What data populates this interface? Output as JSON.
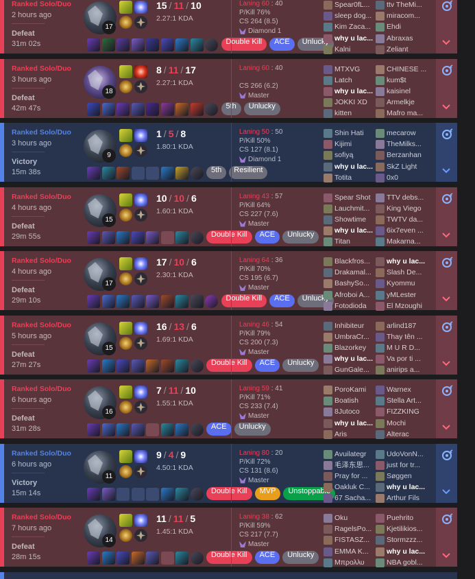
{
  "colors": {
    "loss_bg": "#59343b",
    "win_bg": "#28344e",
    "loss_accent": "#e84057",
    "win_accent": "#5383e8"
  },
  "matches": [
    {
      "result": "loss",
      "queue": "Ranked Solo/Duo",
      "ago": "2 hours ago",
      "outcome": "Defeat",
      "duration": "31m 02s",
      "level": "17",
      "kills": "15",
      "deaths": "11",
      "assists": "10",
      "kda": "2.27:1 KDA",
      "laning": "Laning 60",
      "laning_opp": "40",
      "pkill": "P/Kill 76%",
      "cs": "CS 264 (8.5)",
      "rank": "Diamond 1",
      "badges": [
        {
          "label": "Double Kill",
          "style": "red"
        },
        {
          "label": "ACE",
          "style": "blue"
        },
        {
          "label": "Unlucky",
          "style": "gray"
        }
      ],
      "items": [
        "#6a3cb8",
        "#2f6a3a",
        "#5b3ea0",
        "#7a5cc8",
        "#3a3a9a",
        "#4a4ac0",
        "#2a7ac8",
        "#2a8aa0",
        "#4a4a58"
      ],
      "team1": [
        "Spear0fL...",
        "sleep dog...",
        "Kim Zaca...",
        "why u lac...",
        "Kalni"
      ],
      "team2": [
        "ttv TheMi...",
        "miracom...",
        "Ehdi",
        "Abraxas",
        "Zeliant"
      ],
      "me": 3
    },
    {
      "result": "loss",
      "queue": "Ranked Solo/Duo",
      "ago": "3 hours ago",
      "outcome": "Defeat",
      "duration": "42m 47s",
      "level": "18",
      "kills": "8",
      "deaths": "11",
      "assists": "17",
      "kda": "2.27:1 KDA",
      "laning": "Laning 60",
      "laning_opp": "40",
      "pkill": "",
      "cs": "CS 266 (6.2)",
      "rank": "Master",
      "badges": [
        {
          "label": "5th",
          "style": "gray"
        },
        {
          "label": "Unlucky",
          "style": "gray"
        }
      ],
      "items": [
        "#3a4ac0",
        "#4a6ad0",
        "#6a3cb8",
        "#5a5ab8",
        "#4a2a90",
        "#8a3a9a",
        "#c86a2a",
        "#c83a2a",
        "#4a4a58"
      ],
      "team1": [
        "MTXVG",
        "Latch",
        "why u lac...",
        "JOKKI XD",
        "kitten"
      ],
      "team2": [
        "CHINESE ...",
        "kum$t",
        "kaisinel",
        "Armelkje",
        "Mafro ma..."
      ],
      "me": 2
    },
    {
      "result": "win",
      "queue": "Ranked Solo/Duo",
      "ago": "3 hours ago",
      "outcome": "Victory",
      "duration": "15m 38s",
      "level": "9",
      "kills": "1",
      "deaths": "5",
      "assists": "8",
      "kda": "1.80:1 KDA",
      "laning": "Laning 50",
      "laning_opp": "50",
      "pkill": "P/Kill 50%",
      "cs": "CS 127 (8.1)",
      "rank": "Diamond 1",
      "badges": [
        {
          "label": "5th",
          "style": "gray"
        },
        {
          "label": "Resilient",
          "style": "gray"
        }
      ],
      "items": [
        "#6a3cb8",
        "#2a8aa0",
        "#a04a2a",
        "empty",
        "empty",
        "#2a7ac8",
        "#c8a02a",
        "#4a4a58"
      ],
      "team1": [
        "Shin Hati",
        "Kijimi",
        "sofiyą",
        "why u lac...",
        "Totita"
      ],
      "team2": [
        "mecarow",
        "TheMilks...",
        "Berzanhan",
        "SkZ Light",
        "0x0"
      ],
      "me": 3
    },
    {
      "result": "loss",
      "queue": "Ranked Solo/Duo",
      "ago": "4 hours ago",
      "outcome": "Defeat",
      "duration": "29m 55s",
      "level": "15",
      "kills": "10",
      "deaths": "10",
      "assists": "6",
      "kda": "1.60:1 KDA",
      "laning": "Laning 43",
      "laning_opp": "57",
      "pkill": "P/Kill 64%",
      "cs": "CS 227 (7.6)",
      "rank": "Master",
      "badges": [
        {
          "label": "Double Kill",
          "style": "red"
        },
        {
          "label": "ACE",
          "style": "blue"
        },
        {
          "label": "Unlucky",
          "style": "gray"
        }
      ],
      "items": [
        "#6a3cb8",
        "#5a5ab8",
        "#2a7ac8",
        "#4a4ac0",
        "#7a5cc8",
        "empty",
        "#2a8aa0",
        "#4a4a58"
      ],
      "team1": [
        "Spear Shot",
        "Lauchmit...",
        "Showtime",
        "why u lac...",
        "Titan"
      ],
      "team2": [
        "TTV debs...",
        "King Viego",
        "TWTV da...",
        "6ix7even ...",
        "Makarna..."
      ],
      "me": 3
    },
    {
      "result": "loss",
      "queue": "Ranked Solo/Duo",
      "ago": "4 hours ago",
      "outcome": "Defeat",
      "duration": "29m 10s",
      "level": "17",
      "kills": "17",
      "deaths": "10",
      "assists": "6",
      "kda": "2.30:1 KDA",
      "laning": "Laning 64",
      "laning_opp": "36",
      "pkill": "P/Kill 70%",
      "cs": "CS 195 (6.7)",
      "rank": "Master",
      "badges": [
        {
          "label": "Double Kill",
          "style": "red"
        },
        {
          "label": "ACE",
          "style": "blue"
        },
        {
          "label": "Unlucky",
          "style": "gray"
        }
      ],
      "items": [
        "#6a3cb8",
        "#4a6ad0",
        "#2a7ac8",
        "#5a5ab8",
        "#7a5cc8",
        "#a04a2a",
        "#2a8aa0",
        "#4a4a58",
        "#8a3ab8"
      ],
      "team1": [
        "Blackfros...",
        "Drakamal...",
        "BashySo...",
        "Afroboi A...",
        "Fotodioda"
      ],
      "team2": [
        "why u lac...",
        "Slash De...",
        "Kyommu",
        "yMLester",
        "El Mzoughi"
      ],
      "me": 5
    },
    {
      "result": "loss",
      "queue": "Ranked Solo/Duo",
      "ago": "5 hours ago",
      "outcome": "Defeat",
      "duration": "27m 27s",
      "level": "15",
      "kills": "16",
      "deaths": "13",
      "assists": "6",
      "kda": "1.69:1 KDA",
      "laning": "Laning 46",
      "laning_opp": "54",
      "pkill": "P/Kill 79%",
      "cs": "CS 200 (7.3)",
      "rank": "Master",
      "badges": [
        {
          "label": "Double Kill",
          "style": "red"
        },
        {
          "label": "ACE",
          "style": "blue"
        },
        {
          "label": "Unlucky",
          "style": "gray"
        }
      ],
      "items": [
        "#6a3cb8",
        "#2a7ac8",
        "#4a4ac0",
        "#5a5ab8",
        "#c86a2a",
        "#a04a2a",
        "#2a8aa0",
        "#4a4a58"
      ],
      "team1": [
        "Inhibiteur",
        "UmbraCr...",
        "Blazorkey",
        "why u lac...",
        "GunGale..."
      ],
      "team2": [
        "arlind187",
        "Thay tên ...",
        "M U R D...",
        "Va por ti ...",
        "anirips a..."
      ],
      "me": 3
    },
    {
      "result": "loss",
      "queue": "Ranked Solo/Duo",
      "ago": "6 hours ago",
      "outcome": "Defeat",
      "duration": "31m 28s",
      "level": "16",
      "kills": "7",
      "deaths": "11",
      "assists": "10",
      "kda": "1.55:1 KDA",
      "laning": "Laning 59",
      "laning_opp": "41",
      "pkill": "P/Kill 71%",
      "cs": "CS 233 (7.4)",
      "rank": "Master",
      "badges": [
        {
          "label": "ACE",
          "style": "blue"
        },
        {
          "label": "Unlucky",
          "style": "gray"
        }
      ],
      "items": [
        "#6a3cb8",
        "#4a6ad0",
        "#2a7ac8",
        "#5a5ab8",
        "empty",
        "#2a8aa0",
        "#2a7ac8",
        "#4a4a58"
      ],
      "team1": [
        "PoroKami",
        "Boatish",
        "8Jutoco",
        "why u lac...",
        "Aris"
      ],
      "team2": [
        "Warnex",
        "Stella Art...",
        "FIZZKING",
        "Mochi",
        "Alterac"
      ],
      "me": 3
    },
    {
      "result": "win",
      "queue": "Ranked Solo/Duo",
      "ago": "6 hours ago",
      "outcome": "Victory",
      "duration": "15m 14s",
      "level": "11",
      "kills": "9",
      "deaths": "4",
      "assists": "9",
      "kda": "4.50:1 KDA",
      "laning": "Laning 80",
      "laning_opp": "20",
      "pkill": "P/Kill 72%",
      "cs": "CS 131 (8.6)",
      "rank": "Master",
      "badges": [
        {
          "label": "Double Kill",
          "style": "red"
        },
        {
          "label": "MVP",
          "style": "orange"
        },
        {
          "label": "Unstoppable",
          "style": "green"
        }
      ],
      "items": [
        "#6a3cb8",
        "#7a5cc8",
        "empty",
        "empty",
        "empty",
        "#2a7ac8",
        "#2a8aa0",
        "#4a4a58"
      ],
      "team1": [
        "Avuilategr",
        "毛泽东思...",
        "Pray for ...",
        "Oakluk C...",
        "67 Sacha..."
      ],
      "team2": [
        "UdoVonN...",
        "just for tr...",
        "Søggen",
        "why u lac...",
        "Arthur Fils"
      ],
      "me": 8
    },
    {
      "result": "loss",
      "queue": "Ranked Solo/Duo",
      "ago": "7 hours ago",
      "outcome": "Defeat",
      "duration": "28m 15s",
      "level": "14",
      "kills": "11",
      "deaths": "11",
      "assists": "5",
      "kda": "1.45:1 KDA",
      "laning": "Laning 38",
      "laning_opp": "62",
      "pkill": "P/Kill 59%",
      "cs": "CS 217 (7.7)",
      "rank": "Master",
      "badges": [
        {
          "label": "Double Kill",
          "style": "red"
        },
        {
          "label": "ACE",
          "style": "blue"
        },
        {
          "label": "Unlucky",
          "style": "gray"
        }
      ],
      "items": [
        "#6a3cb8",
        "#2a7ac8",
        "#4a4ac0",
        "#c86a2a",
        "#5a5ab8",
        "empty",
        "#2a8aa0",
        "#4a4a58"
      ],
      "team1": [
        "Oku",
        "RagelsPo...",
        "FISTASZ...",
        "EMMA K...",
        "Μπρολλυ"
      ],
      "team2": [
        "Puehrito",
        "Kjetilikios...",
        "Stormzzz...",
        "why u lac...",
        "NBA gobl..."
      ],
      "me": 8
    }
  ]
}
